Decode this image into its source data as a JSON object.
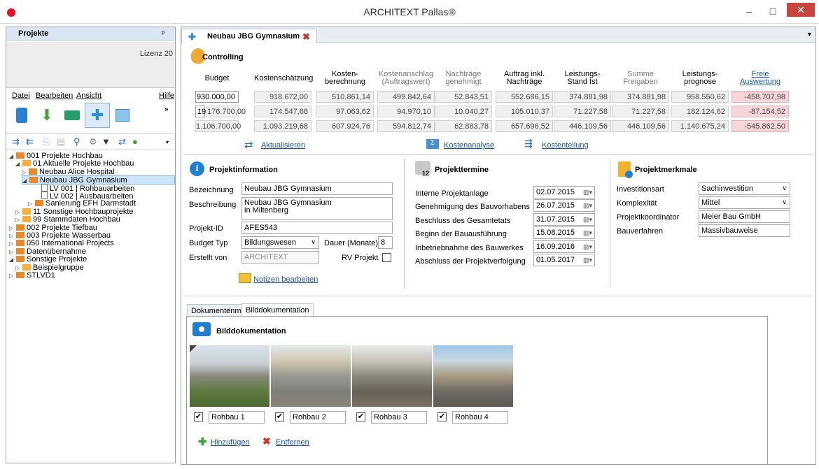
{
  "window": {
    "title": "ARCHITEXT Pallas®",
    "minimize": "–",
    "maximize": "□",
    "close": "✕"
  },
  "left_panel": {
    "header": "Projekte",
    "pin": "ᵖ",
    "license": "Lizenz 20",
    "menu": [
      "Datei",
      "Bearbeiten",
      "Ansicht",
      "Hilfe"
    ],
    "tree": [
      {
        "label": "001 Projekte Hochbau",
        "level": 0,
        "expanded": true,
        "type": "foldo"
      },
      {
        "label": "01 Aktuelle Projekte Hochbau",
        "level": 1,
        "expanded": true,
        "type": "fold"
      },
      {
        "label": "Neubau Alice Hospital",
        "level": 2,
        "expanded": false,
        "type": "foldo"
      },
      {
        "label": "Neubau JBG Gymnasium",
        "level": 2,
        "expanded": true,
        "type": "foldo",
        "selected": true
      },
      {
        "label": "LV 001 | Rohbauarbeiten",
        "level": 4,
        "type": "doc"
      },
      {
        "label": "LV 002 | Ausbauarbeiten",
        "level": 4,
        "type": "doc"
      },
      {
        "label": "Sanierung EFH Darmstadt",
        "level": 3,
        "type": "foldo"
      },
      {
        "label": "11 Sonstige Hochbauprojekte",
        "level": 1,
        "expanded": false,
        "type": "fold"
      },
      {
        "label": "99 Stammdaten Hochbau",
        "level": 1,
        "expanded": false,
        "type": "fold"
      },
      {
        "label": "002 Projekte Tiefbau",
        "level": 0,
        "expanded": false,
        "type": "foldo"
      },
      {
        "label": "003 Projekte Wasserbau",
        "level": 0,
        "expanded": false,
        "type": "foldo"
      },
      {
        "label": "050 International Projects",
        "level": 0,
        "expanded": false,
        "type": "foldo"
      },
      {
        "label": "Datenübernahme",
        "level": 0,
        "expanded": false,
        "type": "foldo"
      },
      {
        "label": "Sonstige Projekte",
        "level": 0,
        "expanded": true,
        "type": "foldo"
      },
      {
        "label": "Beispielgruppe",
        "level": 1,
        "expanded": false,
        "type": "fold"
      },
      {
        "label": "STLVD1",
        "level": 0,
        "expanded": false,
        "type": "foldo"
      }
    ]
  },
  "tab": {
    "label": "Neubau JBG Gymnasium",
    "close": "✖"
  },
  "controlling": {
    "title": "Controlling",
    "columns": [
      "Budget",
      "Kostenschätzung",
      "Kosten-\nberechnung",
      "Kostenanschlag\n(Auftragswert)",
      "Nachträge\ngenehmigt",
      "Auftrag inkl.\nNachträge",
      "Leistungs-\nStand Ist",
      "Summe\nFreigaben",
      "Leistungs-\nprognose",
      "Freie\nAuswertung"
    ],
    "rows": [
      [
        "930.000,00",
        "918.672,00",
        "510.861,14",
        "499.842,64",
        "52.843,51",
        "552.686,15",
        "374.881,98",
        "374.881,98",
        "958.550,62",
        "-458.707,98"
      ],
      [
        "176.700,00",
        "174.547,68",
        "97.063,62",
        "94.970,10",
        "10.040,27",
        "105.010,37",
        "71.227,58",
        "71.227,58",
        "182.124,62",
        "-87.154,52"
      ],
      [
        "1.106.700,00",
        "1.093.219,68",
        "607.924,76",
        "594.812,74",
        "62.883,78",
        "657.696,52",
        "446.109,56",
        "446.109,56",
        "1.140.675,24",
        "-545.862,50"
      ]
    ],
    "row2_prefix": "19",
    "actions": [
      "Aktualisieren",
      "Kostenanalyse",
      "Kostenteilung"
    ]
  },
  "info": {
    "title": "Projektinformation",
    "bezeichnung_label": "Bezeichnung",
    "bezeichnung": "Neubau JBG Gymnasium",
    "beschreibung_label": "Beschreibung",
    "beschreibung_1": "Neubau JBG Gymnasium",
    "beschreibung_2": "in Miltenberg",
    "id_label": "Projekt-ID",
    "id": "AFES543",
    "typ_label": "Budget Typ",
    "typ": "Bildungswesen",
    "dauer_label": "Dauer (Monate)",
    "dauer": "8",
    "erstellt_label": "Erstellt von",
    "erstellt": "ARCHITEXT",
    "rv_label": "RV Projekt",
    "notes": "Notizen bearbeiten"
  },
  "termine": {
    "title": "Projekttermine",
    "icon_num": "12",
    "items": [
      {
        "label": "Interne Projektanlage",
        "date": "02.07.2015"
      },
      {
        "label": "Genehmigung des Bauvorhabens",
        "date": "26.07.2015"
      },
      {
        "label": "Beschluss des Gesamtetats",
        "date": "31.07.2015"
      },
      {
        "label": "Beginn der Bauausführung",
        "date": "15.08.2015"
      },
      {
        "label": "Inbetriebnahme des Bauwerkes",
        "date": "16.09.2016"
      },
      {
        "label": "Abschluss der Projektverfolgung",
        "date": "01.05.2017"
      }
    ]
  },
  "merkmale": {
    "title": "Projektmerkmale",
    "items": [
      {
        "label": "Investitionsart",
        "value": "Sachinvestition",
        "select": true
      },
      {
        "label": "Komplexität",
        "value": "Mittel",
        "select": true
      },
      {
        "label": "Projektkoordinator",
        "value": "Meier Bau GmbH",
        "select": false
      },
      {
        "label": "Bauverfahren",
        "value": "Massivbauweise",
        "select": false
      }
    ]
  },
  "doc": {
    "tabs": [
      "Dokumentenmappe",
      "Bilddokumentation"
    ],
    "title": "Bilddokumentation",
    "photos": [
      "Rohbau 1",
      "Rohbau 2",
      "Rohbau 3",
      "Rohbau 4"
    ],
    "add": "Hinzufügen",
    "remove": "Entfernen"
  }
}
